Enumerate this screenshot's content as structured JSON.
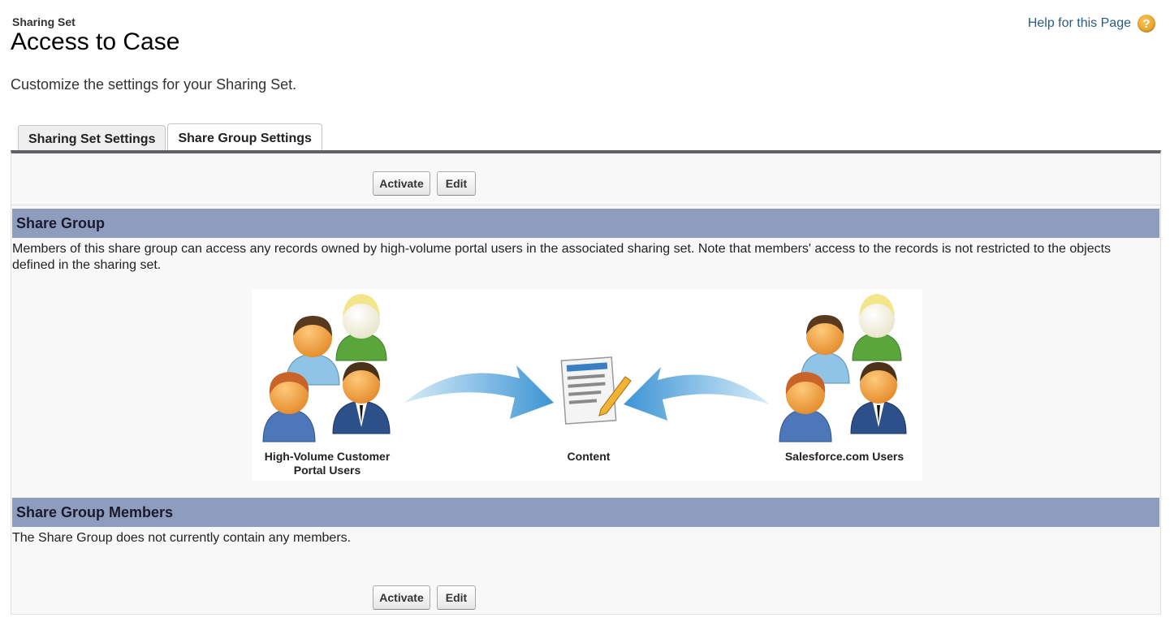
{
  "header": {
    "page_type": "Sharing Set",
    "title": "Access to Case",
    "help_label": "Help for this Page",
    "help_icon_glyph": "?",
    "description": "Customize the settings for your Sharing Set."
  },
  "tabs": [
    {
      "label": "Sharing Set Settings",
      "active": false
    },
    {
      "label": "Share Group Settings",
      "active": true
    }
  ],
  "buttons": {
    "activate_label": "Activate",
    "edit_label": "Edit"
  },
  "share_group": {
    "heading": "Share Group",
    "text": "Members of this share group can access any records owned by high-volume portal users in the associated sharing set. Note that members' access to the records is not restricted to the objects defined in the sharing set.",
    "diagram": {
      "left_label_line1": "High-Volume Customer",
      "left_label_line2": "Portal Users",
      "center_label": "Content",
      "right_label": "Salesforce.com Users"
    }
  },
  "members": {
    "heading": "Share Group Members",
    "text": "The Share Group does not currently contain any members."
  },
  "colors": {
    "section_header": "#8e9dbd",
    "tab_bar": "#5f6166",
    "link": "#2a5a8a",
    "help_icon": "#e08f12",
    "arrow": "#4a9fd8"
  }
}
